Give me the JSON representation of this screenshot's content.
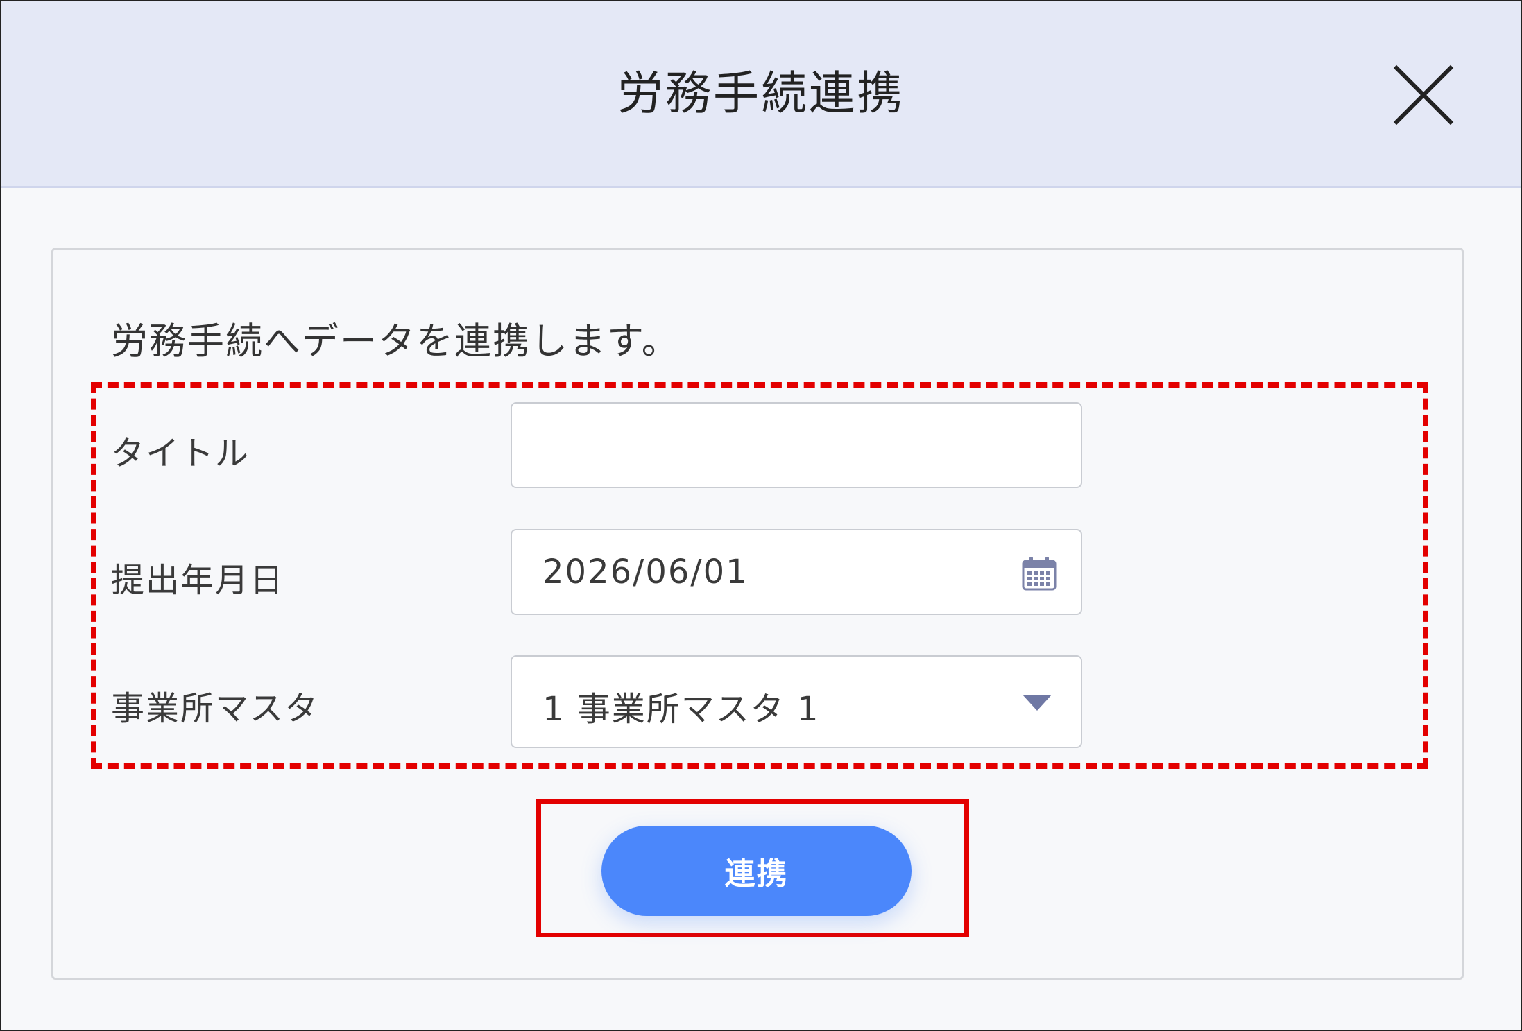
{
  "dialog": {
    "title": "労務手続連携",
    "close_icon": "close-icon"
  },
  "form": {
    "intro": "労務手続へデータを連携します。",
    "fields": [
      {
        "label": "タイトル",
        "value": ""
      },
      {
        "label": "提出年月日",
        "value": "2026/06/01",
        "icon": "calendar-icon"
      },
      {
        "label": "事業所マスタ",
        "value": "1 事業所マスタ 1",
        "icon": "chevron-down-icon"
      }
    ],
    "submit_label": "連携"
  },
  "colors": {
    "header_bg": "#e4e8f6",
    "button": "#4b87fb",
    "highlight": "#e30000",
    "icon": "#7b82a8"
  }
}
